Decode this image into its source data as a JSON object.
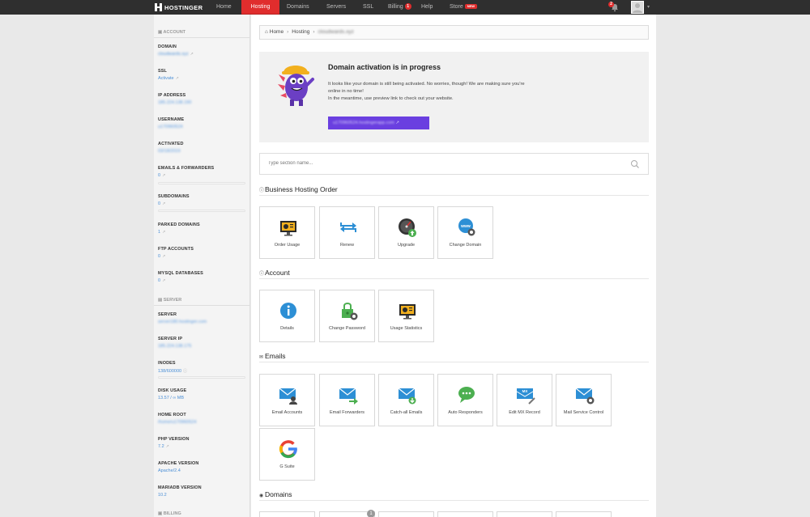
{
  "nav": {
    "brand": "HOSTINGER",
    "items": [
      {
        "label": "Home"
      },
      {
        "label": "Hosting"
      },
      {
        "label": "Domains"
      },
      {
        "label": "Servers"
      },
      {
        "label": "SSL"
      },
      {
        "label": "Billing",
        "badge": "1"
      },
      {
        "label": "Help"
      },
      {
        "label": "Store",
        "badge": "NEW"
      }
    ],
    "bell_count": "2"
  },
  "sidebar": {
    "account_title": "ACCOUNT",
    "server_title": "SERVER",
    "billing_title": "BILLING",
    "account_fields": [
      {
        "label": "DOMAIN",
        "value": "cloudwards.xyz"
      },
      {
        "label": "SSL",
        "value": "Activate"
      },
      {
        "label": "IP ADDRESS",
        "value": "185.224.138.190"
      },
      {
        "label": "USERNAME",
        "value": "u170960524"
      },
      {
        "label": "ACTIVATED",
        "value": "03/18/2019"
      },
      {
        "label": "EMAILS & FORWARDERS",
        "value": "0"
      },
      {
        "label": "SUBDOMAINS",
        "value": "0"
      },
      {
        "label": "PARKED DOMAINS",
        "value": "1"
      },
      {
        "label": "FTP ACCOUNTS",
        "value": "0"
      },
      {
        "label": "MYSQL DATABASES",
        "value": "0"
      }
    ],
    "server_fields": [
      {
        "label": "SERVER",
        "value": "server180.hostinger.com"
      },
      {
        "label": "SERVER IP",
        "value": "185.224.138.175"
      },
      {
        "label": "INODES",
        "value": "138/600000"
      },
      {
        "label": "DISK USAGE",
        "value": "13.57 / ∞ MB"
      },
      {
        "label": "HOME ROOT",
        "value": "/home/u170960524"
      },
      {
        "label": "PHP VERSION",
        "value": "7.2"
      },
      {
        "label": "APACHE VERSION",
        "value": "Apache/2.4"
      },
      {
        "label": "MARIADB VERSION",
        "value": "10.2"
      }
    ]
  },
  "breadcrumb": {
    "home": "Home",
    "hosting": "Hosting",
    "domain": "cloudwards.xyz"
  },
  "activation": {
    "title": "Domain activation is in progress",
    "line1": "It looks like your domain is still being activated. No worries, though! We are making sure you're",
    "line2": "online in no time!",
    "line3": "In the meantime, use preview link to check out your website.",
    "preview_link": "u170960524.hostingerapp.com"
  },
  "search": {
    "placeholder": "Type section name..."
  },
  "sections": {
    "order": {
      "title": "Business Hosting Order",
      "tiles": [
        {
          "label": "Order Usage",
          "icon": "order-usage-icon"
        },
        {
          "label": "Renew",
          "icon": "renew-icon"
        },
        {
          "label": "Upgrade",
          "icon": "upgrade-icon"
        },
        {
          "label": "Change Domain",
          "icon": "change-domain-icon"
        }
      ]
    },
    "account": {
      "title": "Account",
      "tiles": [
        {
          "label": "Details",
          "icon": "details-icon"
        },
        {
          "label": "Change Password",
          "icon": "change-password-icon"
        },
        {
          "label": "Usage Statistics",
          "icon": "usage-statistics-icon"
        }
      ]
    },
    "emails": {
      "title": "Emails",
      "tiles": [
        {
          "label": "Email Accounts",
          "icon": "email-accounts-icon"
        },
        {
          "label": "Email Forwarders",
          "icon": "email-forwarders-icon"
        },
        {
          "label": "Catch-all Emails",
          "icon": "catch-all-emails-icon"
        },
        {
          "label": "Auto Responders",
          "icon": "auto-responders-icon"
        },
        {
          "label": "Edit MX Record",
          "icon": "mx-record-icon"
        },
        {
          "label": "Mail Service Control",
          "icon": "mail-service-control-icon"
        },
        {
          "label": "G Suite",
          "icon": "g-suite-icon"
        }
      ]
    },
    "domains": {
      "title": "Domains",
      "badge": "1"
    }
  },
  "colors": {
    "brand_red": "#e02d2d",
    "topbar": "#2f2f2f",
    "link_blue": "#4b8fd6",
    "preview_purple": "#6a3fe0"
  }
}
